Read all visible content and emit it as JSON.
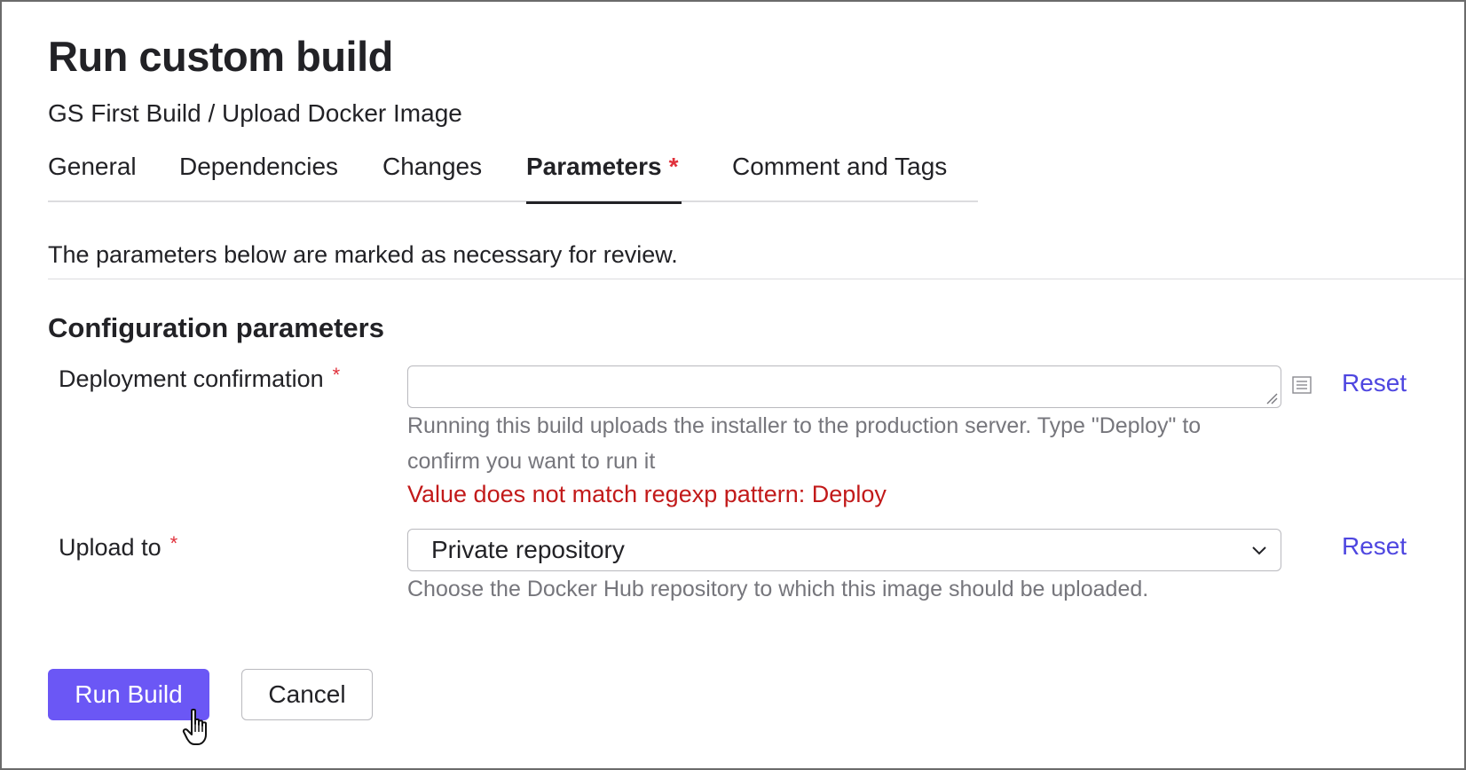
{
  "dialog": {
    "title": "Run custom build",
    "breadcrumb": "GS First Build / Upload Docker Image"
  },
  "tabs": [
    {
      "label": "General",
      "active": false
    },
    {
      "label": "Dependencies",
      "active": false
    },
    {
      "label": "Changes",
      "active": false
    },
    {
      "label": "Parameters",
      "active": true,
      "required_mark": "*"
    },
    {
      "label": "Comment and Tags",
      "active": false
    }
  ],
  "notice": "The parameters below are marked as necessary for review.",
  "section": {
    "title": "Configuration parameters"
  },
  "params": [
    {
      "label": "Deployment confirmation",
      "required_mark": "*",
      "value": "",
      "help": "Running this build uploads the installer to the production server. Type \"Deploy\" to confirm you want to run it",
      "error": "Value does not match regexp pattern: Deploy",
      "reset_label": "Reset",
      "icons": {
        "expand": "list-icon",
        "resize": "resize-grip-icon"
      }
    },
    {
      "label": "Upload to",
      "required_mark": "*",
      "selected": "Private repository",
      "help": "Choose the Docker Hub repository to which this image should be uploaded.",
      "reset_label": "Reset",
      "icons": {
        "dropdown": "chevron-down-icon"
      }
    }
  ],
  "actions": {
    "run_label": "Run Build",
    "cancel_label": "Cancel"
  },
  "colors": {
    "accent": "#6b57f5",
    "link": "#4e46e0",
    "error": "#c21a1a",
    "required": "#e0303b"
  }
}
